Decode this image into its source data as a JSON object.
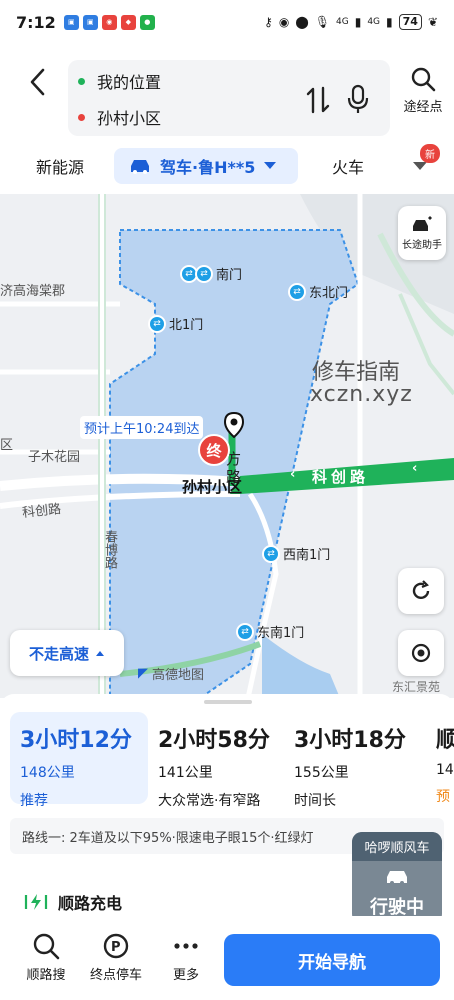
{
  "status_bar": {
    "time": "7:12",
    "network_1": "4G",
    "network_2": "4G",
    "battery": "74"
  },
  "route_input": {
    "origin": "我的位置",
    "destination": "孙村小区",
    "waypoint_label": "途经点"
  },
  "modes": {
    "new_energy": "新能源",
    "drive": "驾车·鲁H**5",
    "train": "火车",
    "badge": "新"
  },
  "map": {
    "long_trip_helper": "长途助手",
    "area_name": "济高海棠郡",
    "garden_name": "子木花园",
    "road_kechuang": "科创路",
    "road_kechuang_left": "科创路",
    "road_chunbo": "春博路",
    "road_fang": "方",
    "road_lu": "路",
    "watermark_line1": "修车指南",
    "watermark_line2": "xczn.xyz",
    "eta": "预计上午10:24到达",
    "destination_marker": "终",
    "destination_name": "孙村小区",
    "gates": [
      "南门",
      "东北门",
      "北1门",
      "西南1门",
      "东南1门"
    ],
    "no_highway": "不走高速",
    "amap_logo": "高德地图",
    "east_area": "东汇景苑",
    "left_edge_char": "区"
  },
  "routes": [
    {
      "time": "3小时12分",
      "distance": "148公里",
      "tag": "推荐"
    },
    {
      "time": "2小时58分",
      "distance": "141公里",
      "tag": "大众常选·有窄路"
    },
    {
      "time": "3小时18分",
      "distance": "155公里",
      "tag": "时间长"
    },
    {
      "time": "顺",
      "distance": "14",
      "tag": "预"
    }
  ],
  "route_summary": "路线一: 2车道及以下95%·限速电子眼15个·红绿灯",
  "charging": "顺路充电",
  "float_card": {
    "title": "哈啰顺风车",
    "label": "行驶中"
  },
  "bottom": {
    "tab1": "顺路搜",
    "tab2": "终点停车",
    "tab3": "更多",
    "start_nav": "开始导航"
  },
  "colors": {
    "accent": "#2a7cf7",
    "route_green": "#1fb25a",
    "area_fill": "#b9d3f1"
  }
}
